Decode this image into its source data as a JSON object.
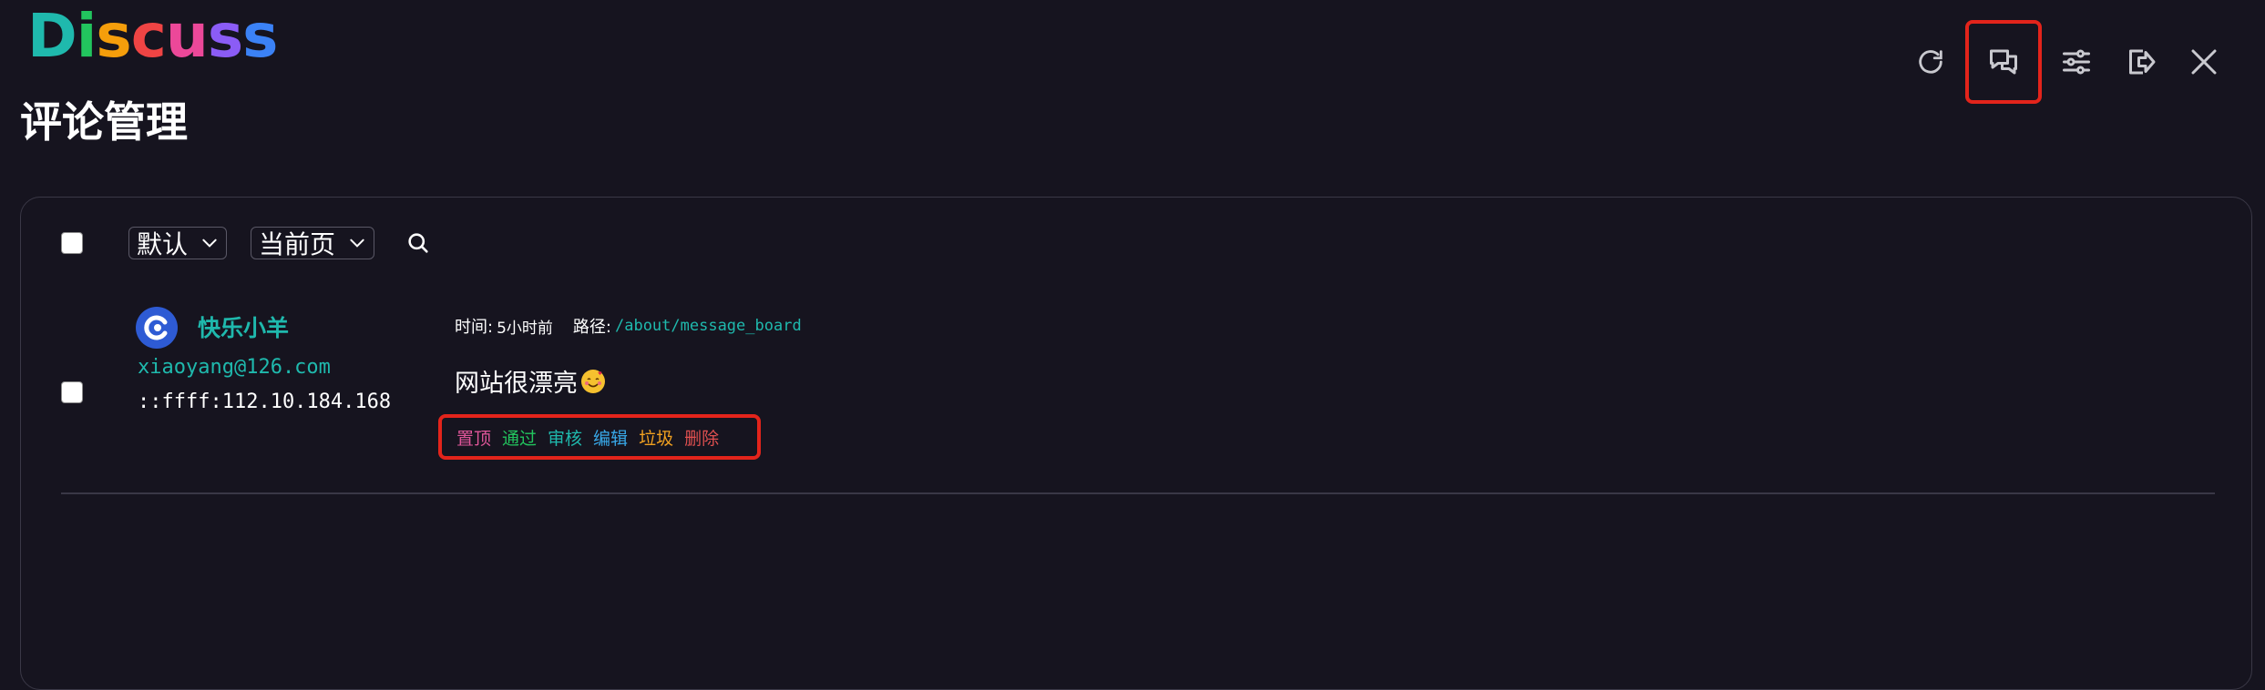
{
  "app": {
    "logo_letters": [
      {
        "char": "D",
        "color": "#1fb9ad"
      },
      {
        "char": "i",
        "color": "#22c55e"
      },
      {
        "char": "s",
        "color": "#f59e0b"
      },
      {
        "char": "c",
        "color": "#ef4444"
      },
      {
        "char": "u",
        "color": "#ec4899"
      },
      {
        "char": "s",
        "color": "#8b5cf6"
      },
      {
        "char": "s",
        "color": "#3b82f6"
      }
    ]
  },
  "toolbar": {
    "icons": [
      "refresh-icon",
      "comments-icon",
      "settings-sliders-icon",
      "logout-icon",
      "close-icon"
    ],
    "highlight_color": "#e3241b"
  },
  "page": {
    "title": "评论管理"
  },
  "filters": {
    "sort_selected": "默认",
    "scope_selected": "当前页"
  },
  "comments": [
    {
      "nick": "快乐小羊",
      "email": "xiaoyang@126.com",
      "ip": "::ffff:112.10.184.168",
      "time_label": "时间:",
      "time_value": "5小时前",
      "path_label": "路径:",
      "path_value": "/about/message_board",
      "content": "网站很漂亮",
      "emoji": "smiling-face-with-hearts",
      "actions": [
        {
          "label": "置顶",
          "color": "#e0569a"
        },
        {
          "label": "通过",
          "color": "#22c55e"
        },
        {
          "label": "审核",
          "color": "#1fb9ad"
        },
        {
          "label": "编辑",
          "color": "#38a8e8"
        },
        {
          "label": "垃圾",
          "color": "#f0a020"
        },
        {
          "label": "删除",
          "color": "#e05050"
        }
      ]
    }
  ]
}
